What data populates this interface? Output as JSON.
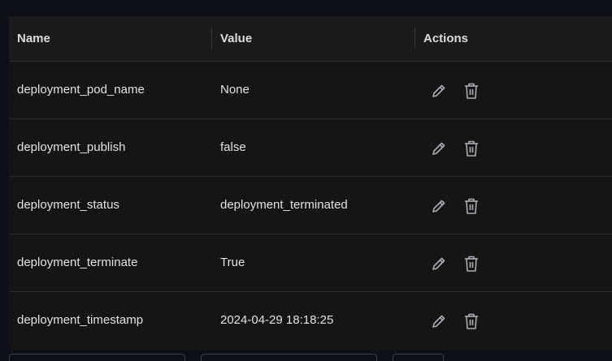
{
  "table": {
    "headers": {
      "name": "Name",
      "value": "Value",
      "actions": "Actions"
    },
    "rows": [
      {
        "name": "deployment_pod_name",
        "value": "None"
      },
      {
        "name": "deployment_publish",
        "value": "false"
      },
      {
        "name": "deployment_status",
        "value": "deployment_terminated"
      },
      {
        "name": "deployment_terminate",
        "value": "True"
      },
      {
        "name": "deployment_timestamp",
        "value": "2024-04-29 18:18:25"
      }
    ]
  },
  "icons": {
    "edit": "pencil-icon",
    "delete": "trash-icon"
  },
  "colors": {
    "page_background": "#0d1117",
    "table_background": "#151515",
    "header_background": "#1b1b1b",
    "icon": "#a9adb3"
  }
}
